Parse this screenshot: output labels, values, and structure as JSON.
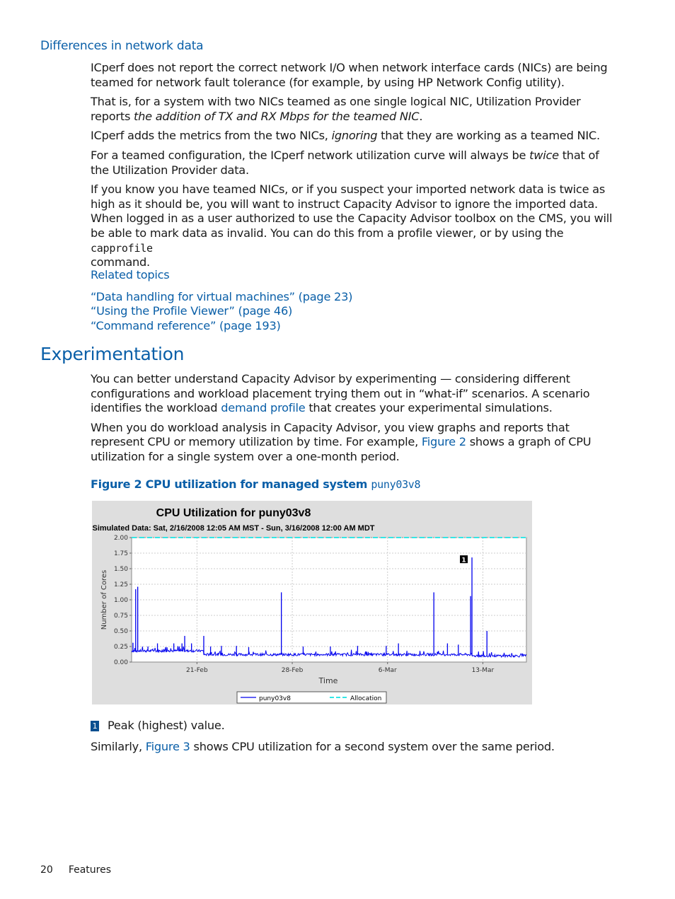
{
  "section": {
    "heading": "Differences in network data",
    "paragraphs": {
      "p1": "ICperf does not report the correct network I/O when network interface cards (NICs) are being teamed for network fault tolerance (for example, by using HP Network Config utility).",
      "p2_a": "That is, for a system with two NICs teamed as one single logical NIC, Utilization Provider reports ",
      "p2_b": "the addition of TX and RX Mbps for the teamed NIC",
      "p2_c": ".",
      "p3_a": "ICperf adds the metrics from the two NICs, ",
      "p3_b": "ignoring",
      "p3_c": " that they are working as a teamed NIC.",
      "p4_a": "For a teamed configuration, the ICperf network utilization curve will always be ",
      "p4_b": "twice",
      "p4_c": " that of the Utilization Provider data.",
      "p5_a": "If you know you have teamed NICs, or if you suspect your imported network data is twice as high as it should be, you will want to instruct Capacity Advisor to ignore the imported data. When logged in as a user authorized to use the Capacity Advisor toolbox on the CMS, you will be able to mark data as invalid. You can do this from a profile viewer, or by using the ",
      "p5_code": "capprofile",
      "p5_c": " command."
    },
    "related_title": "Related topics",
    "related_links": [
      "“Data handling for virtual machines” (page 23)",
      "“Using the Profile Viewer” (page 46)",
      "“Command reference” (page 193)"
    ]
  },
  "experimentation": {
    "heading": "Experimentation",
    "p1_a": "You can better understand Capacity Advisor by experimenting — considering different configurations and workload placement trying them out in “what-if” scenarios. A scenario identifies the workload ",
    "p1_link": "demand profile",
    "p1_c": " that creates your experimental simulations.",
    "p2_a": "When you do workload analysis in Capacity Advisor, you view graphs and reports that represent CPU or memory utilization by time. For example, ",
    "p2_link": "Figure 2",
    "p2_c": " shows a graph of CPU utilization for a single system over a one-month period.",
    "figure_caption": "Figure 2 CPU utilization for managed system ",
    "figure_caption_code": "puny03v8",
    "callout_number": "1",
    "callout_text": "Peak (highest) value.",
    "p3_a": "Similarly, ",
    "p3_link": "Figure 3",
    "p3_c": " shows CPU utilization for a second system over the same period."
  },
  "footer": {
    "page_number": "20",
    "section": "Features"
  },
  "chart_data": {
    "type": "line",
    "title": "CPU Utilization for puny03v8",
    "subtitle": "Simulated Data: Sat, 2/16/2008 12:05 AM MST - Sun, 3/16/2008 12:00 AM MDT",
    "xlabel": "Time",
    "ylabel": "Number of Cores",
    "xlim_days": [
      0,
      29
    ],
    "ylim": [
      0,
      2.0
    ],
    "yticks": [
      "0.00",
      "0.25",
      "0.50",
      "0.75",
      "1.00",
      "1.25",
      "1.50",
      "1.75",
      "2.00"
    ],
    "xticks": [
      {
        "label": "21-Feb",
        "day": 4.8
      },
      {
        "label": "28-Feb",
        "day": 11.8
      },
      {
        "label": "6-Mar",
        "day": 18.8
      },
      {
        "label": "13-Mar",
        "day": 25.8
      }
    ],
    "grid": true,
    "legend_position": "bottom",
    "series": [
      {
        "name": "puny03v8",
        "color": "#0000ee",
        "style": "solid",
        "baseline_segments": [
          {
            "from_day": 0,
            "to_day": 5.3,
            "value": 0.18
          },
          {
            "from_day": 5.3,
            "to_day": 25.0,
            "value": 0.12
          },
          {
            "from_day": 25.0,
            "to_day": 29,
            "value": 0.1
          }
        ],
        "spikes": [
          {
            "day": 0.1,
            "value": 0.31
          },
          {
            "day": 0.3,
            "value": 1.17
          },
          {
            "day": 0.45,
            "value": 1.21
          },
          {
            "day": 1.2,
            "value": 0.25
          },
          {
            "day": 1.9,
            "value": 0.3
          },
          {
            "day": 2.5,
            "value": 0.24
          },
          {
            "day": 3.1,
            "value": 0.3
          },
          {
            "day": 3.5,
            "value": 0.25
          },
          {
            "day": 3.7,
            "value": 0.3
          },
          {
            "day": 3.9,
            "value": 0.42
          },
          {
            "day": 4.4,
            "value": 0.3
          },
          {
            "day": 5.3,
            "value": 0.42
          },
          {
            "day": 5.8,
            "value": 0.25
          },
          {
            "day": 6.6,
            "value": 0.26
          },
          {
            "day": 7.7,
            "value": 0.26
          },
          {
            "day": 8.6,
            "value": 0.24
          },
          {
            "day": 11.0,
            "value": 1.12
          },
          {
            "day": 12.6,
            "value": 0.25
          },
          {
            "day": 14.6,
            "value": 0.25
          },
          {
            "day": 16.6,
            "value": 0.26
          },
          {
            "day": 18.7,
            "value": 0.26
          },
          {
            "day": 19.6,
            "value": 0.3
          },
          {
            "day": 22.2,
            "value": 1.12
          },
          {
            "day": 23.2,
            "value": 0.3
          },
          {
            "day": 24.0,
            "value": 0.28
          },
          {
            "day": 24.9,
            "value": 1.06
          },
          {
            "day": 25.0,
            "value": 1.68
          },
          {
            "day": 26.1,
            "value": 0.5
          }
        ]
      },
      {
        "name": "Allocation",
        "color": "#33e6e6",
        "style": "dashed",
        "constant_value": 2.0
      }
    ],
    "annotations": [
      {
        "label": "1",
        "meaning": "Peak (highest) value",
        "day": 25.0,
        "value": 1.68
      }
    ]
  }
}
